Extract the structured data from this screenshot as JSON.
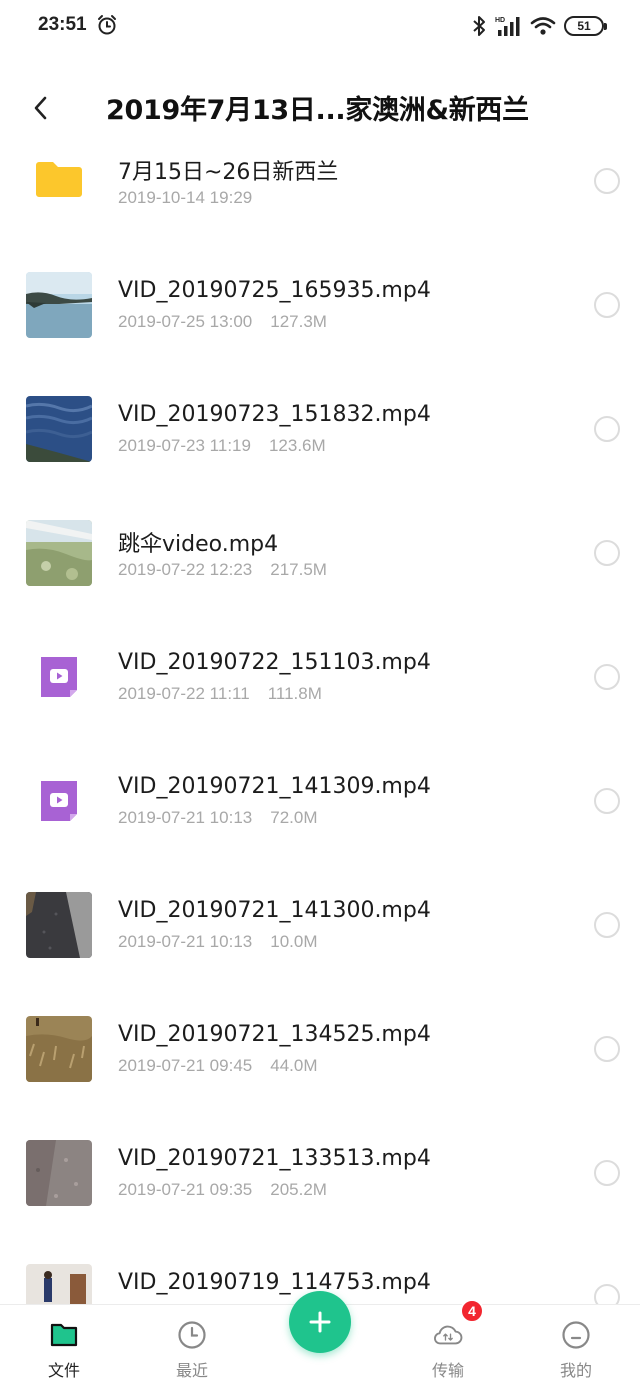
{
  "status_bar": {
    "time": "23:51",
    "battery": "51",
    "icons": [
      "alarm-icon",
      "bluetooth-icon",
      "hd-signal-icon",
      "wifi-icon",
      "battery-icon"
    ]
  },
  "header": {
    "title": "2019年7月13日...家澳洲&新西兰",
    "back_icon": "chevron-left-icon"
  },
  "files": [
    {
      "name": "7月15日~26日新西兰",
      "date": "2019-10-14 19:29",
      "size": "",
      "type": "folder",
      "thumb": "folder-icon"
    },
    {
      "name": "VID_20190725_165935.mp4",
      "date": "2019-07-25 13:00",
      "size": "127.3M",
      "type": "video",
      "thumb": "lake-thumbnail"
    },
    {
      "name": "VID_20190723_151832.mp4",
      "date": "2019-07-23 11:19",
      "size": "123.6M",
      "type": "video",
      "thumb": "sea-thumbnail"
    },
    {
      "name": "跳伞video.mp4",
      "date": "2019-07-22 12:23",
      "size": "217.5M",
      "type": "video",
      "thumb": "skydive-thumbnail"
    },
    {
      "name": "VID_20190722_151103.mp4",
      "date": "2019-07-22 11:11",
      "size": "111.8M",
      "type": "video",
      "thumb": "video-file-icon"
    },
    {
      "name": "VID_20190721_141309.mp4",
      "date": "2019-07-21 10:13",
      "size": "72.0M",
      "type": "video",
      "thumb": "video-file-icon"
    },
    {
      "name": "VID_20190721_141300.mp4",
      "date": "2019-07-21 10:13",
      "size": "10.0M",
      "type": "video",
      "thumb": "road-thumbnail"
    },
    {
      "name": "VID_20190721_134525.mp4",
      "date": "2019-07-21 09:45",
      "size": "44.0M",
      "type": "video",
      "thumb": "grass-thumbnail"
    },
    {
      "name": "VID_20190721_133513.mp4",
      "date": "2019-07-21 09:35",
      "size": "205.2M",
      "type": "video",
      "thumb": "ground-thumbnail"
    },
    {
      "name": "VID_20190719_114753.mp4",
      "date": "",
      "size": "",
      "type": "video",
      "thumb": "room-thumbnail"
    }
  ],
  "bottom_nav": {
    "items": [
      {
        "label": "文件",
        "icon": "folder-tab-icon",
        "active": true
      },
      {
        "label": "最近",
        "icon": "clock-icon",
        "active": false
      },
      {
        "label": "传输",
        "icon": "cloud-transfer-icon",
        "active": false,
        "badge": "4"
      },
      {
        "label": "我的",
        "icon": "profile-face-icon",
        "active": false
      }
    ],
    "fab_icon": "plus-icon"
  },
  "colors": {
    "accent": "#1fc48d",
    "folder": "#fcc72c",
    "video_icon": "#a862d4",
    "badge": "#f2262f",
    "meta_text": "#a8a8a8"
  }
}
